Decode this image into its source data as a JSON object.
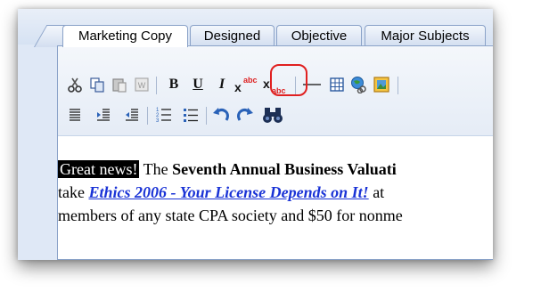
{
  "tabs": [
    {
      "label": "Marketing Copy",
      "active": true
    },
    {
      "label": "Designed",
      "active": false
    },
    {
      "label": "Objective",
      "active": false
    },
    {
      "label": "Major Subjects",
      "active": false
    }
  ],
  "toolbar": {
    "bold_label": "B",
    "underline_label": "U",
    "italic_label": "I",
    "italic_highlighted": true,
    "highlight_color": "#e02020"
  },
  "content": {
    "line1": {
      "highlighted": "Great news!",
      "plain": " The ",
      "bold": "Seventh Annual Business Valuati"
    },
    "line2": {
      "prefix": "take ",
      "link": "Ethics 2006 - Your License Depends on It!",
      "suffix": " at"
    },
    "line3": {
      "text": "members of any state CPA society and $50 for nonme"
    }
  }
}
